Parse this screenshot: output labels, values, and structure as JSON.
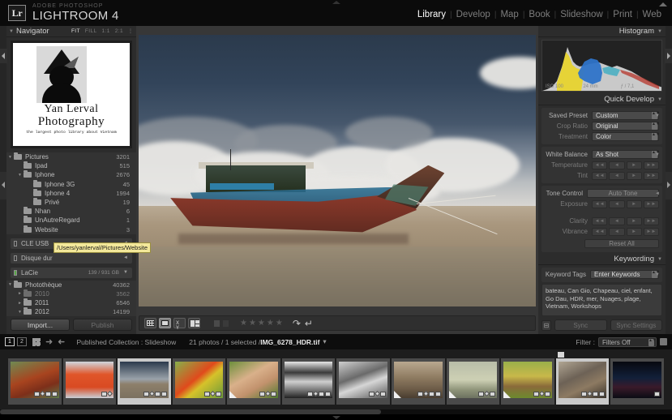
{
  "app": {
    "brand_small": "ADOBE PHOTOSHOP",
    "brand_large": "LIGHTROOM 4",
    "logo_text": "Lr"
  },
  "modules": [
    {
      "label": "Library",
      "active": true
    },
    {
      "label": "Develop",
      "active": false
    },
    {
      "label": "Map",
      "active": false
    },
    {
      "label": "Book",
      "active": false
    },
    {
      "label": "Slideshow",
      "active": false
    },
    {
      "label": "Print",
      "active": false
    },
    {
      "label": "Web",
      "active": false
    }
  ],
  "navigator": {
    "title": "Navigator",
    "zoom_levels": [
      {
        "label": "FIT",
        "active": true
      },
      {
        "label": "FILL",
        "active": false
      },
      {
        "label": "1:1",
        "active": false
      },
      {
        "label": "2:1",
        "active": false
      }
    ],
    "logo": {
      "line1": "Yan Lerval",
      "line2": "Photography",
      "line3": "the largest photo library about Vietnam"
    }
  },
  "folders": [
    {
      "name": "Pictures",
      "count": "3201",
      "indent": 0,
      "twisty": "down",
      "dim": false
    },
    {
      "name": "Ipad",
      "count": "515",
      "indent": 1,
      "twisty": "",
      "dim": false
    },
    {
      "name": "Iphone",
      "count": "2676",
      "indent": 1,
      "twisty": "down",
      "dim": false
    },
    {
      "name": "Iphone 3G",
      "count": "45",
      "indent": 2,
      "twisty": "",
      "dim": false
    },
    {
      "name": "Iphone 4",
      "count": "1994",
      "indent": 2,
      "twisty": "",
      "dim": false
    },
    {
      "name": "Privé",
      "count": "19",
      "indent": 2,
      "twisty": "",
      "dim": false
    },
    {
      "name": "Nhan",
      "count": "6",
      "indent": 1,
      "twisty": "",
      "dim": false
    },
    {
      "name": "UnAutreRegard",
      "count": "1",
      "indent": 1,
      "twisty": "",
      "dim": false
    },
    {
      "name": "Website",
      "count": "3",
      "indent": 1,
      "twisty": "",
      "dim": false
    }
  ],
  "volumes": [
    {
      "name": "CLE USB",
      "capacity": "",
      "led": "off"
    },
    {
      "name": "Disque dur",
      "capacity": "",
      "led": "off"
    },
    {
      "name": "LaCie",
      "capacity": "139 / 931 GB",
      "led": "on"
    }
  ],
  "tooltip": "/Users/yanlerval/Pictures/Website",
  "lacie_folders": [
    {
      "name": "Photothèque",
      "count": "40362",
      "indent": 0,
      "twisty": "down",
      "dim": false
    },
    {
      "name": "2010",
      "count": "3562",
      "indent": 1,
      "twisty": "right",
      "dim": true
    },
    {
      "name": "2011",
      "count": "6546",
      "indent": 1,
      "twisty": "right",
      "dim": false
    },
    {
      "name": "2012",
      "count": "14199",
      "indent": 1,
      "twisty": "down",
      "dim": false
    }
  ],
  "left_buttons": {
    "import": "Import...",
    "publish": "Publish"
  },
  "toolbar": {
    "views": [
      "grid-view",
      "loupe-view",
      "compare-view",
      "survey-view"
    ],
    "active_view": "loupe-view",
    "rating": "★★★★★",
    "rotate_left": "↷",
    "rotate_right": "↵"
  },
  "histogram": {
    "title": "Histogram",
    "iso": "ISO 100",
    "focal": "24 mm",
    "aperture": "ƒ / 7,1",
    "shutter": ""
  },
  "quick_develop": {
    "title": "Quick Develop",
    "rows": [
      {
        "label": "Saved Preset",
        "value": "Custom",
        "type": "select",
        "dim": false
      },
      {
        "label": "Crop Ratio",
        "value": "Original",
        "type": "select",
        "dim": true
      },
      {
        "label": "Treatment",
        "value": "Color",
        "type": "select",
        "dim": true
      },
      {
        "label": "White Balance",
        "value": "As Shot",
        "type": "select",
        "dim": false
      },
      {
        "label": "Temperature",
        "value": "",
        "type": "steppers",
        "dim": true
      },
      {
        "label": "Tint",
        "value": "",
        "type": "steppers",
        "dim": true
      }
    ],
    "stepper_labels": [
      "◄◄",
      "◄",
      "►",
      "►►"
    ]
  },
  "tone_control": {
    "title": "Tone Control",
    "auto_tone": "Auto Tone",
    "rows": [
      {
        "label": "Exposure",
        "type": "steppers"
      },
      {
        "label": "Clarity",
        "type": "steppers"
      },
      {
        "label": "Vibrance",
        "type": "steppers"
      }
    ],
    "reset_all": "Reset All"
  },
  "keywording": {
    "title": "Keywording",
    "field_label": "Keyword Tags",
    "field_value": "Enter Keywords",
    "tags": "bateau, Can Gio, Chapeau, ciel, enfant, Go Dau, HDR, mer, Nuages, plage, Vietnam, Workshops"
  },
  "sync": {
    "sync_label": "Sync",
    "sync_settings_label": "Sync Settings"
  },
  "filmstrip_bar": {
    "screen1": "1",
    "screen2": "2",
    "collection_label": "Published Collection : Slideshow",
    "photo_count": "21 photos / 1 selected / ",
    "filename": "IMG_6278_HDR.tif",
    "filter_label": "Filter :",
    "filter_value": "Filters Off"
  },
  "filmstrip": [
    {
      "name": "thumb-child-red",
      "selected": false,
      "corner": false,
      "flag": false,
      "badges": 4
    },
    {
      "name": "thumb-vietnam-flag",
      "selected": false,
      "corner": false,
      "flag": false,
      "badges": 2
    },
    {
      "name": "thumb-boat-hdr",
      "selected": true,
      "corner": false,
      "flag": false,
      "badges": 4
    },
    {
      "name": "thumb-red-flower",
      "selected": false,
      "corner": false,
      "flag": false,
      "badges": 3
    },
    {
      "name": "thumb-two-girls-hats",
      "selected": false,
      "corner": true,
      "flag": false,
      "badges": 3
    },
    {
      "name": "thumb-old-man-bw",
      "selected": false,
      "corner": false,
      "flag": false,
      "badges": 4
    },
    {
      "name": "thumb-stones-bw",
      "selected": false,
      "corner": false,
      "flag": false,
      "badges": 3
    },
    {
      "name": "thumb-bicycle",
      "selected": false,
      "corner": true,
      "flag": false,
      "badges": 4
    },
    {
      "name": "thumb-beach-figure",
      "selected": false,
      "corner": true,
      "flag": false,
      "badges": 3
    },
    {
      "name": "thumb-field-buffalo",
      "selected": false,
      "corner": true,
      "flag": false,
      "badges": 3
    },
    {
      "name": "thumb-market-wall",
      "selected": true,
      "corner": false,
      "flag": true,
      "badges": 4
    },
    {
      "name": "thumb-city-night",
      "selected": false,
      "corner": false,
      "flag": false,
      "badges": 1
    }
  ],
  "colors": {
    "panel_bg": "#2c2c2c",
    "center_bg": "#373737",
    "accent_blue": "#2e7fa6",
    "tooltip_bg": "#f3e89a"
  }
}
